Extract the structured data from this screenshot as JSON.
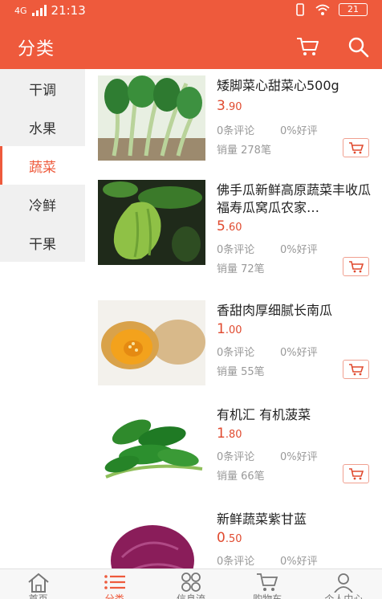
{
  "status": {
    "network": "4G",
    "time": "21:13",
    "battery": "21"
  },
  "header": {
    "title": "分类",
    "cart_icon": "cart-icon",
    "search_icon": "search-icon"
  },
  "sidebar": {
    "items": [
      {
        "label": "干调"
      },
      {
        "label": "水果"
      },
      {
        "label": "蔬菜",
        "active": true
      },
      {
        "label": "冷鲜"
      },
      {
        "label": "干果"
      }
    ]
  },
  "products": [
    {
      "name": "矮脚菜心甜菜心500g",
      "price_int": "3",
      "price_dec": ".90",
      "reviews": "0条评论",
      "good_rate": "0%好评",
      "sales": "销量 278笔"
    },
    {
      "name": "佛手瓜新鲜高原蔬菜丰收瓜福寿瓜窝瓜农家…",
      "price_int": "5",
      "price_dec": ".60",
      "reviews": "0条评论",
      "good_rate": "0%好评",
      "sales": "销量 72笔"
    },
    {
      "name": "香甜肉厚细腻长南瓜",
      "price_int": "1",
      "price_dec": ".00",
      "reviews": "0条评论",
      "good_rate": "0%好评",
      "sales": "销量 55笔"
    },
    {
      "name": "有机汇 有机菠菜",
      "price_int": "1",
      "price_dec": ".80",
      "reviews": "0条评论",
      "good_rate": "0%好评",
      "sales": "销量 66笔"
    },
    {
      "name": "新鲜蔬菜紫甘蓝",
      "price_int": "0",
      "price_dec": ".50",
      "reviews": "0条评论",
      "good_rate": "0%好评",
      "sales": ""
    }
  ],
  "bottom_nav": [
    {
      "label": "首页",
      "icon": "home-icon"
    },
    {
      "label": "分类",
      "icon": "list-icon",
      "active": true
    },
    {
      "label": "信息流",
      "icon": "grid-icon"
    },
    {
      "label": "购物车",
      "icon": "cart-icon"
    },
    {
      "label": "个人中心",
      "icon": "user-icon"
    }
  ],
  "colors": {
    "accent": "#ee5a3c",
    "price": "#e04a2f",
    "muted": "#999999"
  }
}
